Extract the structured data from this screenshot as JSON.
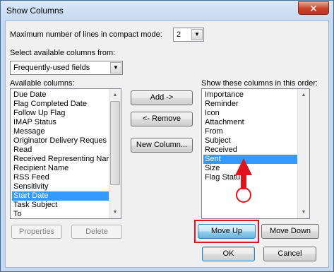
{
  "window": {
    "title": "Show Columns",
    "close_label": "✕"
  },
  "max_lines": {
    "label": "Maximum number of lines in compact mode:",
    "value": "2"
  },
  "select_from": {
    "label": "Select available columns from:",
    "value": "Frequently-used fields"
  },
  "available": {
    "label": "Available columns:",
    "items": [
      "Due Date",
      "Flag Completed Date",
      "Follow Up Flag",
      "IMAP Status",
      "Message",
      "Originator Delivery Reques",
      "Read",
      "Received Representing Nar",
      "Recipient Name",
      "RSS Feed",
      "Sensitivity",
      "Start Date",
      "Task Subject",
      "To"
    ],
    "selected_index": 11
  },
  "show": {
    "label": "Show these columns in this order:",
    "items": [
      "Importance",
      "Reminder",
      "Icon",
      "Attachment",
      "From",
      "Subject",
      "Received",
      "Sent",
      "Size",
      "Flag Statu"
    ],
    "selected_index": 7
  },
  "buttons": {
    "add": "Add ->",
    "remove": "<- Remove",
    "new_column": "New Column...",
    "properties": "Properties",
    "delete": "Delete",
    "move_up": "Move Up",
    "move_down": "Move Down",
    "ok": "OK",
    "cancel": "Cancel"
  },
  "colors": {
    "selection": "#3399ff",
    "annotation": "#e0141e"
  }
}
